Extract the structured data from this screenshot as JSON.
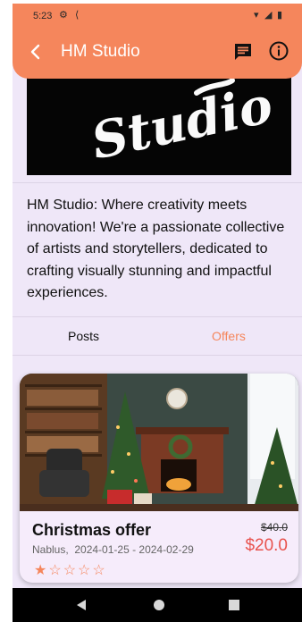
{
  "status_bar": {
    "time": "5:23"
  },
  "app_bar": {
    "title": "HM Studio"
  },
  "icons": {
    "back": "arrow-back-icon",
    "chat": "chat-icon",
    "info": "info-icon",
    "settings": "gear-icon",
    "signal": "signal-icon",
    "battery": "battery-icon",
    "wifi": "wifi-icon"
  },
  "cover": {
    "logo_text": "Studio"
  },
  "profile": {
    "bio": "HM Studio: Where creativity meets innovation! We're a passionate collective of artists and storytellers, dedicated to crafting visually stunning and impactful experiences."
  },
  "tabs": [
    {
      "label": "Posts",
      "active": false
    },
    {
      "label": "Offers",
      "active": true
    }
  ],
  "offer": {
    "title": "Christmas offer",
    "location": "Nablus,",
    "dates": "2024-01-25 - 2024-02-29",
    "old_price": "$40.0",
    "new_price": "$20.0",
    "rating": 1,
    "max_rating": 5
  },
  "colors": {
    "accent": "#f5865c",
    "price": "#e8534e",
    "background": "#efe7f8"
  }
}
